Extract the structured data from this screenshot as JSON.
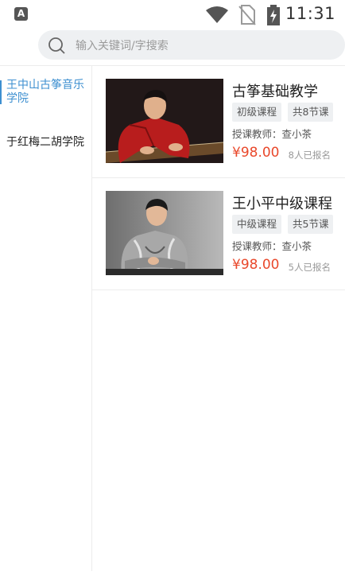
{
  "status_bar": {
    "app_badge": "A",
    "time": "11:31",
    "icons": [
      "wifi-icon",
      "no-sim-icon",
      "battery-charging-icon"
    ]
  },
  "search": {
    "placeholder": "输入关键词/字搜索",
    "value": "",
    "icon": "search-icon"
  },
  "sidebar": {
    "items": [
      {
        "label": "王中山古筝音乐学院",
        "active": true
      },
      {
        "label": "于红梅二胡学院",
        "active": false
      }
    ]
  },
  "courses": [
    {
      "title": "古筝基础教学",
      "level": "初级课程",
      "lessons": "共8节课",
      "teacher": "授课教师：查小茶",
      "price": "¥98.00",
      "enrolled": "8人已报名"
    },
    {
      "title": "王小平中级课程",
      "level": "中级课程",
      "lessons": "共5节课",
      "teacher": "授课教师：查小茶",
      "price": "¥98.00",
      "enrolled": "5人已报名"
    }
  ],
  "colors": {
    "accent": "#3d8fd0",
    "price": "#e9482b",
    "tag_bg": "#eef0f2"
  }
}
